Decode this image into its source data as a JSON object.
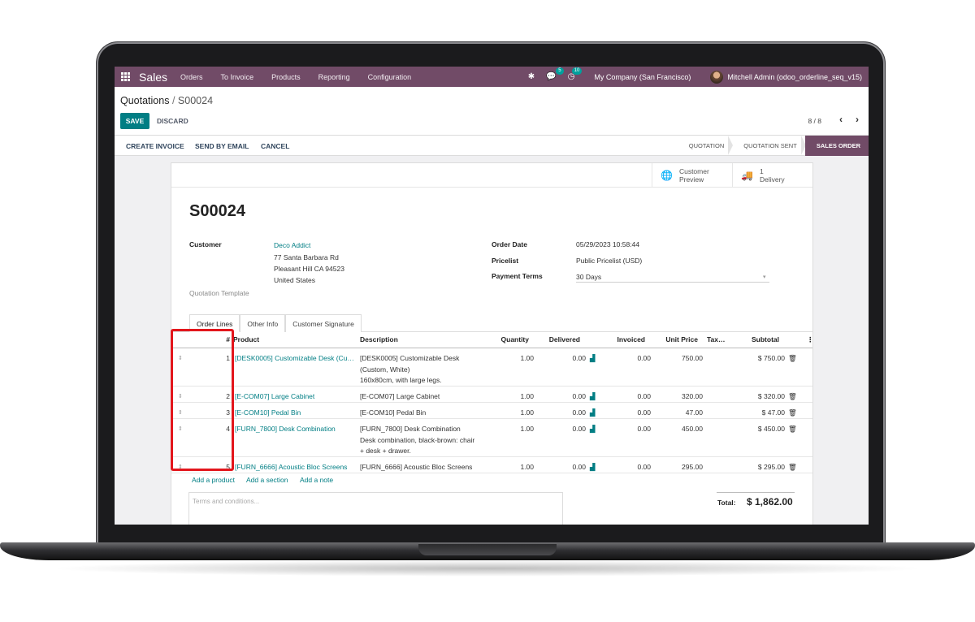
{
  "navbar": {
    "brand": "Sales",
    "menu": [
      "Orders",
      "To Invoice",
      "Products",
      "Reporting",
      "Configuration"
    ],
    "chat_badge": "5",
    "activity_badge": "10",
    "company": "My Company (San Francisco)",
    "user": "Mitchell Admin (odoo_orderline_seq_v15)",
    "icons": [
      "bug-icon",
      "chat-icon",
      "clock-icon"
    ]
  },
  "breadcrumb": {
    "parent": "Quotations",
    "separator": "/",
    "current": "S00024"
  },
  "control": {
    "save": "SAVE",
    "discard": "DISCARD",
    "pager": "8 / 8"
  },
  "statusbar": {
    "actions": [
      "CREATE INVOICE",
      "SEND BY EMAIL",
      "CANCEL"
    ],
    "stages": [
      "QUOTATION",
      "QUOTATION SENT",
      "SALES ORDER"
    ],
    "active_stage": "SALES ORDER"
  },
  "smart_buttons": {
    "preview_line1": "Customer",
    "preview_line2": "Preview",
    "delivery_line1": "1",
    "delivery_line2": "Delivery"
  },
  "order": {
    "name": "S00024",
    "customer_label": "Customer",
    "customer_name": "Deco Addict",
    "address": [
      "77 Santa Barbara Rd",
      "Pleasant Hill CA 94523",
      "United States"
    ],
    "template_label": "Quotation Template",
    "order_date_label": "Order Date",
    "order_date": "05/29/2023 10:58:44",
    "pricelist_label": "Pricelist",
    "pricelist": "Public Pricelist (USD)",
    "payment_terms_label": "Payment Terms",
    "payment_terms": "30 Days"
  },
  "tabs": [
    "Order Lines",
    "Other Info",
    "Customer Signature"
  ],
  "table": {
    "headers": {
      "seq": "#",
      "product": "Product",
      "description": "Description",
      "quantity": "Quantity",
      "delivered": "Delivered",
      "invoiced": "Invoiced",
      "unit_price": "Unit Price",
      "taxes": "Tax…",
      "subtotal": "Subtotal"
    },
    "rows": [
      {
        "seq": "1",
        "product": "[DESK0005] Customizable Desk (Cu…",
        "description": [
          "[DESK0005] Customizable Desk",
          "(Custom, White)",
          "160x80cm, with large legs."
        ],
        "quantity": "1.00",
        "delivered": "0.00",
        "invoiced": "0.00",
        "unit_price": "750.00",
        "subtotal": "$ 750.00"
      },
      {
        "seq": "2",
        "product": "[E-COM07] Large Cabinet",
        "description": [
          "[E-COM07] Large Cabinet"
        ],
        "quantity": "1.00",
        "delivered": "0.00",
        "invoiced": "0.00",
        "unit_price": "320.00",
        "subtotal": "$ 320.00"
      },
      {
        "seq": "3",
        "product": "[E-COM10] Pedal Bin",
        "description": [
          "[E-COM10] Pedal Bin"
        ],
        "quantity": "1.00",
        "delivered": "0.00",
        "invoiced": "0.00",
        "unit_price": "47.00",
        "subtotal": "$ 47.00"
      },
      {
        "seq": "4",
        "product": "[FURN_7800] Desk Combination",
        "description": [
          "[FURN_7800] Desk Combination",
          "Desk combination, black-brown: chair",
          "+ desk + drawer."
        ],
        "quantity": "1.00",
        "delivered": "0.00",
        "invoiced": "0.00",
        "unit_price": "450.00",
        "subtotal": "$ 450.00"
      },
      {
        "seq": "5",
        "product": "[FURN_6666] Acoustic Bloc Screens",
        "description": [
          "[FURN_6666] Acoustic Bloc Screens"
        ],
        "quantity": "1.00",
        "delivered": "0.00",
        "invoiced": "0.00",
        "unit_price": "295.00",
        "subtotal": "$ 295.00"
      }
    ]
  },
  "add_links": {
    "product": "Add a product",
    "section": "Add a section",
    "note": "Add a note"
  },
  "terms_placeholder": "Terms and conditions...",
  "totals": {
    "label": "Total:",
    "value": "$ 1,862.00"
  },
  "colors": {
    "navbar": "#714b67",
    "primary": "#017e84",
    "highlight": "#e3161c"
  }
}
